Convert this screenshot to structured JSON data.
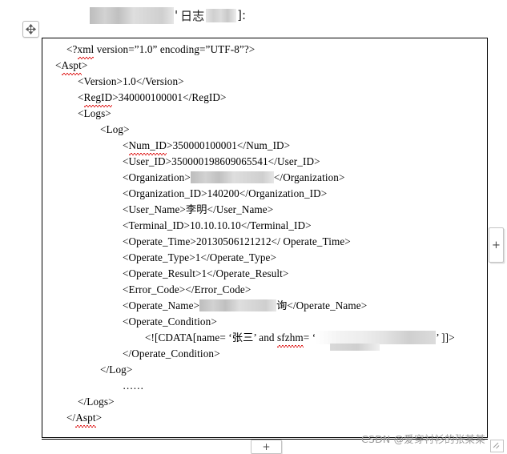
{
  "header": {
    "redacted_block_1": "",
    "label_zhi": "日志",
    "redacted_block_2": "",
    "trailing": "]:",
    "leading_sep": "'"
  },
  "icons": {
    "move_handle": "move-cross-icon",
    "column_add": "+",
    "row_add": "+",
    "resize": "resize-corner-icon"
  },
  "code": {
    "lines": [
      {
        "indent": 1,
        "text": "<?xml version=”1.0” encoding=”UTF-8”?>",
        "squiggle": "xml"
      },
      {
        "indent": 0,
        "text": "<Aspt>",
        "squiggle": "Aspt"
      },
      {
        "indent": 2,
        "text": "<Version>1.0</Version>"
      },
      {
        "indent": 2,
        "text": "<RegID>340000100001</RegID>",
        "squiggle": "RegID"
      },
      {
        "indent": 2,
        "text": "<Logs>"
      },
      {
        "indent": 4,
        "text": "<Log>"
      },
      {
        "indent": 6,
        "text": "<Num_ID>350000100001</Num_ID>",
        "squiggle": "Num_ID"
      },
      {
        "indent": 6,
        "text": "<User_ID>350000198609065541</User_ID>"
      },
      {
        "indent": 6,
        "text": "<Organization>",
        "redact": "redact-org",
        "tail": "</Organization>"
      },
      {
        "indent": 6,
        "text": "<Organization_ID>140200</Organization_ID>"
      },
      {
        "indent": 6,
        "text": "<User_Name>李明</User_Name>"
      },
      {
        "indent": 6,
        "text": "<Terminal_ID>10.10.10.10</Terminal_ID>"
      },
      {
        "indent": 6,
        "text": "<Operate_Time>20130506121212</ Operate_Time>"
      },
      {
        "indent": 6,
        "text": "<Operate_Type>1</Operate_Type>"
      },
      {
        "indent": 6,
        "text": "<Operate_Result>1</Operate_Result>"
      },
      {
        "indent": 6,
        "text": "<Error_Code></Error_Code>"
      },
      {
        "indent": 6,
        "text": "<Operate_Name>",
        "redact": "redact-opname",
        "tail": "询</Operate_Name>"
      },
      {
        "indent": 6,
        "text": "<Operate_Condition>"
      },
      {
        "indent": 8,
        "text": "<![CDATA[name= ‘张三’ and sfzhm= ‘",
        "squiggle_word": "sfzhm",
        "redact": "redact-cdata",
        "tail": "’ ]]>"
      },
      {
        "indent": 6,
        "text": "</Operate_Condition>"
      },
      {
        "indent": 4,
        "text": "</Log>"
      },
      {
        "indent": 6,
        "text": "……"
      },
      {
        "indent": 2,
        "text": "</Logs>"
      },
      {
        "indent": 1,
        "text": "</Aspt>",
        "squiggle": "Aspt"
      }
    ]
  },
  "watermark": {
    "text": "CSDN @爱穿衬衫的张某某"
  }
}
